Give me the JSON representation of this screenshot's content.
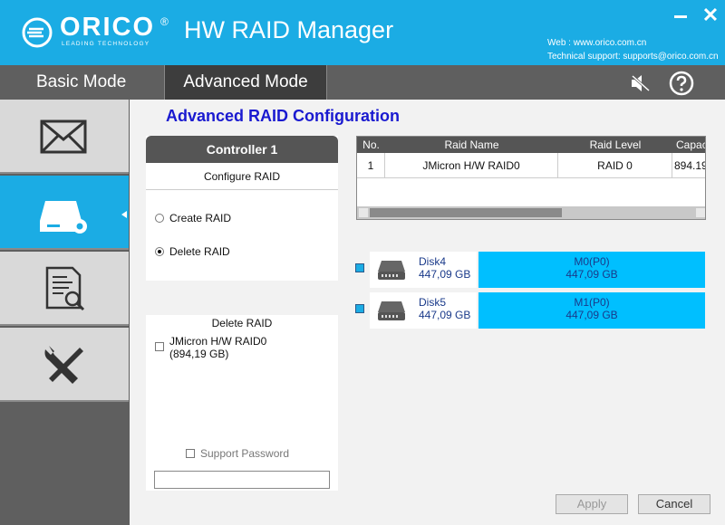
{
  "header": {
    "logo_text": "ORICO",
    "logo_tagline": "LEADING TECHNOLOGY",
    "app_title": "HW RAID Manager",
    "web": "Web : www.orico.com.cn",
    "support": "Technical support: supports@orico.com.cn",
    "brand_color": "#1bace4"
  },
  "tabs": {
    "basic": "Basic Mode",
    "advanced": "Advanced Mode",
    "active": "advanced"
  },
  "sidebar": {
    "items": [
      {
        "icon": "mail-icon",
        "active": false
      },
      {
        "icon": "raid-config-icon",
        "active": true
      },
      {
        "icon": "log-search-icon",
        "active": false
      },
      {
        "icon": "tools-icon",
        "active": false
      }
    ]
  },
  "main": {
    "title": "Advanced RAID Configuration",
    "controller": {
      "title": "Controller 1",
      "subtitle": "Configure RAID",
      "options": [
        {
          "label": "Create RAID",
          "selected": false
        },
        {
          "label": "Delete RAID",
          "selected": true
        }
      ]
    },
    "delete_panel": {
      "title": "Delete RAID",
      "raid_line1": "JMicron H/W RAID0",
      "raid_line2": "(894,19 GB)",
      "support_password": "Support Password",
      "password_value": ""
    },
    "table": {
      "headers": {
        "no": "No.",
        "name": "Raid Name",
        "level": "Raid Level",
        "capacity": "Capacity"
      },
      "rows": [
        {
          "no": "1",
          "name": "JMicron H/W RAID0",
          "level": "RAID 0",
          "capacity": "894.19"
        }
      ]
    },
    "disks": [
      {
        "name": "Disk4",
        "size": "447,09 GB",
        "member": "M0(P0)",
        "member_size": "447,09 GB",
        "checked": true
      },
      {
        "name": "Disk5",
        "size": "447,09 GB",
        "member": "M1(P0)",
        "member_size": "447,09 GB",
        "checked": true
      }
    ],
    "buttons": {
      "apply": "Apply",
      "cancel": "Cancel"
    }
  }
}
